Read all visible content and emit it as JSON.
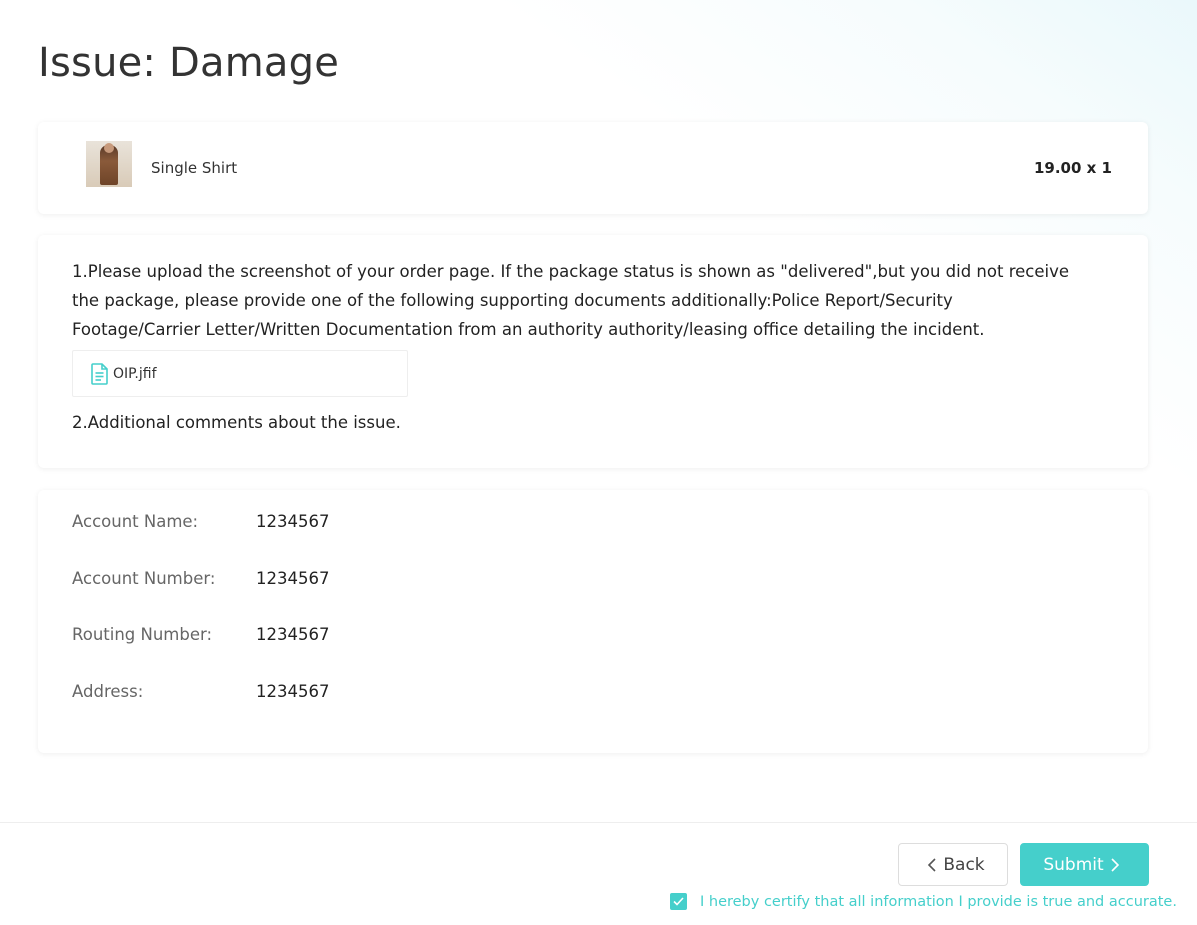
{
  "page": {
    "title": "Issue: Damage"
  },
  "product": {
    "name": "Single Shirt",
    "price": "19.00 x 1",
    "thumbnail_icon": "product-thumbnail"
  },
  "details": {
    "instruction": "1.Please upload the screenshot of your order page. If the package status is shown as \"delivered\",but you did not receive the package, please provide one of the following supporting documents additionally:Police Report/Security Footage/Carrier Letter/Written Documentation from an authority authority/leasing office detailing the incident.",
    "file": {
      "name": "OIP.jfif",
      "icon": "document-icon"
    },
    "comments_label": "2.Additional comments about the issue."
  },
  "account": {
    "rows": [
      {
        "label": "Account Name:",
        "value": "1234567"
      },
      {
        "label": "Account Number:",
        "value": "1234567"
      },
      {
        "label": "Routing Number:",
        "value": "1234567"
      },
      {
        "label": "Address:",
        "value": "1234567"
      }
    ]
  },
  "footer": {
    "back_label": "Back",
    "submit_label": "Submit",
    "certify_text": "I hereby certify that all information I provide is true and accurate.",
    "certify_checked": true
  },
  "colors": {
    "accent": "#45cfcb",
    "label_gray": "#666666"
  }
}
